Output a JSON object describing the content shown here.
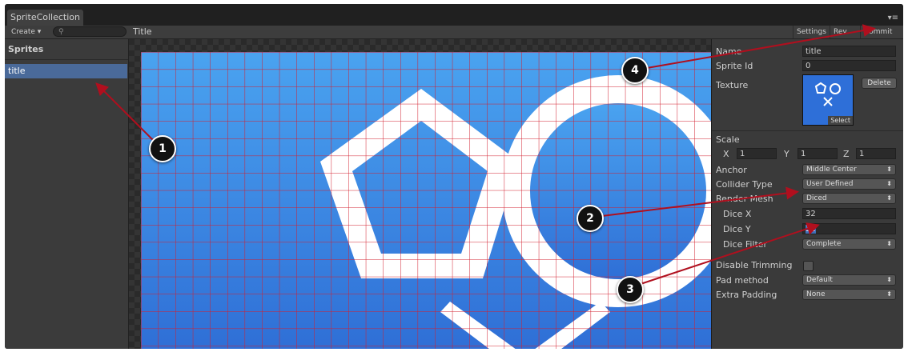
{
  "window": {
    "tab_title": "SpriteCollection",
    "tab_menu_icon": "menu-icon"
  },
  "toolbar": {
    "create_label": "Create",
    "create_arrow": "▾",
    "search_icon": "⚲",
    "title": "Title",
    "settings_label": "Settings",
    "revert_label": "Rev",
    "commit_label": "Commit"
  },
  "sprites_panel": {
    "header": "Sprites",
    "items": [
      {
        "label": "title",
        "selected": true
      }
    ]
  },
  "inspector": {
    "name_label": "Name",
    "name_value": "title",
    "sprite_id_label": "Sprite Id",
    "sprite_id_value": "0",
    "texture_label": "Texture",
    "delete_label": "Delete",
    "select_label": "Select",
    "scale_label": "Scale",
    "scale_x_label": "X",
    "scale_x_value": "1",
    "scale_y_label": "Y",
    "scale_y_value": "1",
    "scale_z_label": "Z",
    "scale_z_value": "1",
    "anchor_label": "Anchor",
    "anchor_value": "Middle Center",
    "collider_label": "Collider Type",
    "collider_value": "User Defined",
    "render_mesh_label": "Render Mesh",
    "render_mesh_value": "Diced",
    "dice_x_label": "Dice X",
    "dice_x_value": "32",
    "dice_y_label": "Dice Y",
    "dice_y_value": "32",
    "dice_filter_label": "Dice Filter",
    "dice_filter_value": "Complete",
    "disable_trimming_label": "Disable Trimming",
    "disable_trimming_checked": false,
    "pad_method_label": "Pad method",
    "pad_method_value": "Default",
    "extra_padding_label": "Extra Padding",
    "extra_padding_value": "None",
    "dropdown_arrow": "⬍"
  },
  "callouts": [
    "1",
    "2",
    "3",
    "4"
  ],
  "colors": {
    "accent_selection": "#4a6a9a",
    "sprite_bg_top": "#4aa3f0",
    "sprite_bg_bottom": "#2f6fd6",
    "dice_grid": "#d21e2d",
    "annotation_arrow": "#b00f1e"
  }
}
